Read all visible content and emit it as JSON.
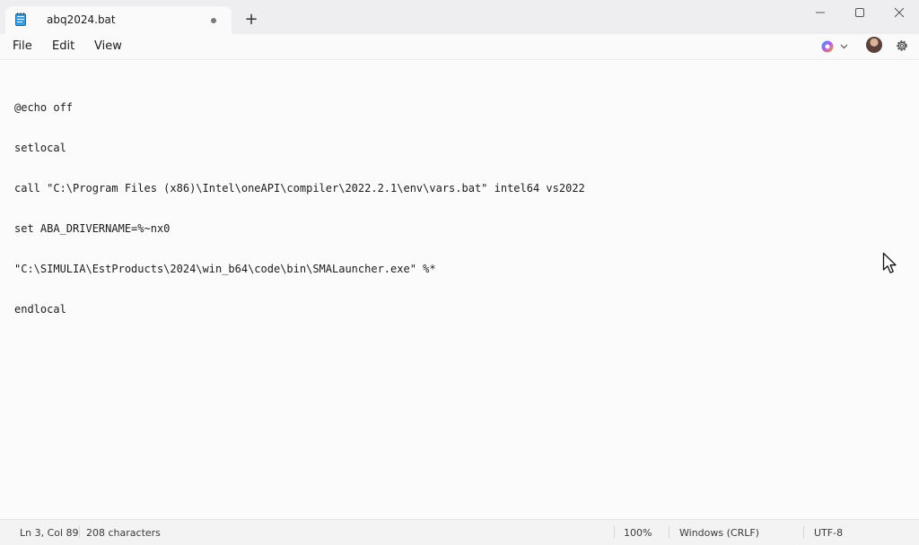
{
  "tab": {
    "title": "abq2024.bat",
    "icon": "notepad-icon",
    "modified": true
  },
  "new_tab_label": "+",
  "window_controls": [
    "minimize",
    "maximize",
    "close"
  ],
  "menu": {
    "items": [
      {
        "label": "File"
      },
      {
        "label": "Edit"
      },
      {
        "label": "View"
      }
    ]
  },
  "toolbar_icons": [
    "copilot-icon",
    "avatar",
    "settings-icon"
  ],
  "editor": {
    "lines": [
      "@echo off",
      "setlocal",
      "call \"C:\\Program Files (x86)\\Intel\\oneAPI\\compiler\\2022.2.1\\env\\vars.bat\" intel64 vs2022",
      "set ABA_DRIVERNAME=%~nx0",
      "\"C:\\SIMULIA\\EstProducts\\2024\\win_b64\\code\\bin\\SMALauncher.exe\" %*",
      "endlocal"
    ]
  },
  "status": {
    "position": "Ln 3, Col 89",
    "characters": "208 characters",
    "zoom": "100%",
    "line_ending": "Windows (CRLF)",
    "encoding": "UTF-8"
  },
  "colors": {
    "titlebar": "#eeeef0",
    "editor_bg": "#fcfbfc",
    "statusbar": "#f3f3f3"
  }
}
